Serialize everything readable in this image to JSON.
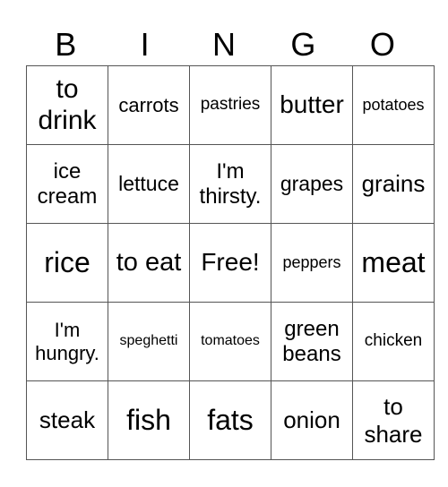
{
  "header": [
    "B",
    "I",
    "N",
    "G",
    "O"
  ],
  "rows": [
    [
      {
        "text": "to drink",
        "size": 30
      },
      {
        "text": "carrots",
        "size": 22
      },
      {
        "text": "pastries",
        "size": 19
      },
      {
        "text": "butter",
        "size": 28
      },
      {
        "text": "potatoes",
        "size": 18
      }
    ],
    [
      {
        "text": "ice cream",
        "size": 24
      },
      {
        "text": "lettuce",
        "size": 23
      },
      {
        "text": "I'm thirsty.",
        "size": 24
      },
      {
        "text": "grapes",
        "size": 23
      },
      {
        "text": "grains",
        "size": 26
      }
    ],
    [
      {
        "text": "rice",
        "size": 32
      },
      {
        "text": "to eat",
        "size": 29
      },
      {
        "text": "Free!",
        "size": 28
      },
      {
        "text": "peppers",
        "size": 18
      },
      {
        "text": "meat",
        "size": 32
      }
    ],
    [
      {
        "text": "I'm hungry.",
        "size": 22
      },
      {
        "text": "speghetti",
        "size": 16
      },
      {
        "text": "tomatoes",
        "size": 16
      },
      {
        "text": "green beans",
        "size": 24
      },
      {
        "text": "chicken",
        "size": 19
      }
    ],
    [
      {
        "text": "steak",
        "size": 26
      },
      {
        "text": "fish",
        "size": 32
      },
      {
        "text": "fats",
        "size": 32
      },
      {
        "text": "onion",
        "size": 26
      },
      {
        "text": "to share",
        "size": 26
      }
    ]
  ]
}
